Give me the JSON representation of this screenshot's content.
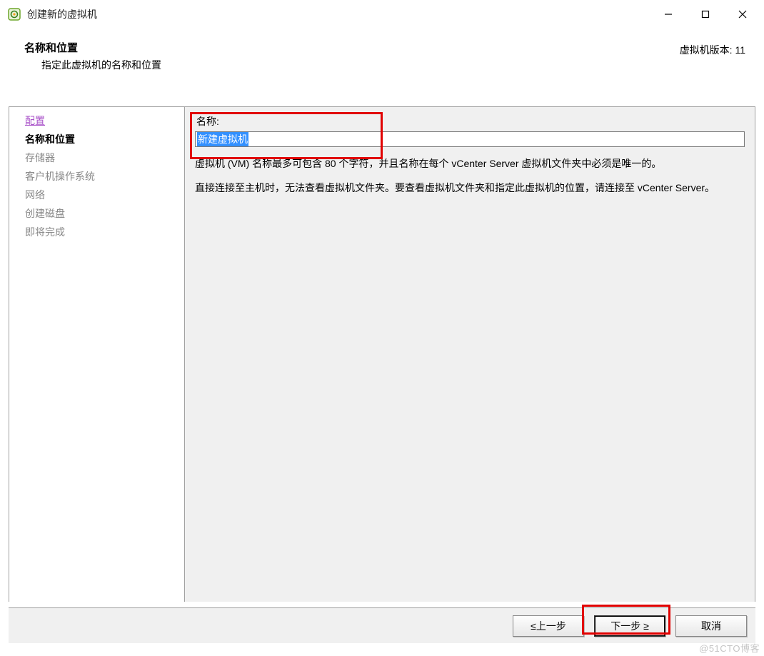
{
  "window": {
    "title": "创建新的虚拟机"
  },
  "header": {
    "title": "名称和位置",
    "subtitle": "指定此虚拟机的名称和位置",
    "version_label": "虚拟机版本: 11"
  },
  "sidebar": {
    "items": [
      {
        "label": "配置",
        "style": "link"
      },
      {
        "label": "名称和位置",
        "style": "bold"
      },
      {
        "label": "存储器",
        "style": "muted"
      },
      {
        "label": "客户机操作系统",
        "style": "muted"
      },
      {
        "label": "网络",
        "style": "muted"
      },
      {
        "label": "创建磁盘",
        "style": "muted"
      },
      {
        "label": "即将完成",
        "style": "muted"
      }
    ]
  },
  "content": {
    "name_label": "名称:",
    "name_value": "新建虚拟机",
    "notice1": "虚拟机 (VM) 名称最多可包含 80 个字符，并且名称在每个 vCenter Server 虚拟机文件夹中必须是唯一的。",
    "notice2": "直接连接至主机时，无法查看虚拟机文件夹。要查看虚拟机文件夹和指定此虚拟机的位置，请连接至 vCenter Server。"
  },
  "footer": {
    "back_label": "≤上一步",
    "next_label": "下一步 ≥",
    "cancel_label": "取消"
  },
  "watermark": "@51CTO博客"
}
